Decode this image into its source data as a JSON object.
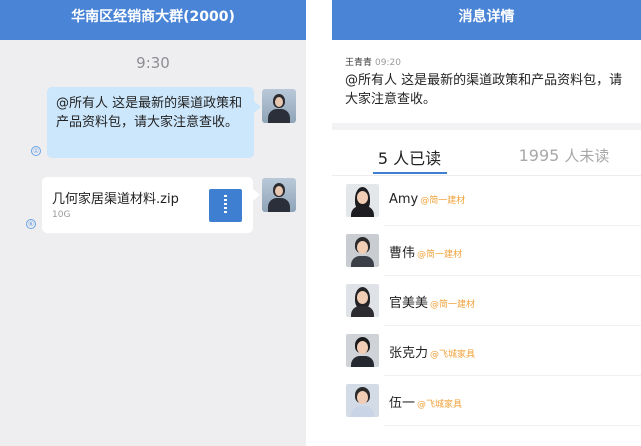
{
  "left": {
    "title": "华南区经销商大群(2000)",
    "time": "9:30",
    "message_text": "@所有人 这是最新的渠道政策和产品资料包，请大家注意查收。",
    "read_indicator_1": "①",
    "read_indicator_2": "⑥",
    "file": {
      "name": "几何家居渠道材料.zip",
      "size": "10G",
      "icon": "zip-file-icon"
    }
  },
  "right": {
    "title": "消息详情",
    "sender": "王青青",
    "sent_time": "09:20",
    "message_text": "@所有人 这是最新的渠道政策和产品资料包，请大家注意查收。",
    "tabs": {
      "read_count": "5",
      "read_label": "人已读",
      "unread_count": "1995",
      "unread_label": "人未读"
    },
    "readers": [
      {
        "name": "Amy",
        "company": "@简一建材"
      },
      {
        "name": "曹伟",
        "company": "@简一建材"
      },
      {
        "name": "官美美",
        "company": "@简一建材"
      },
      {
        "name": "张克力",
        "company": "@飞城家具"
      },
      {
        "name": "伍一",
        "company": "@飞城家具"
      }
    ]
  },
  "colors": {
    "header": "#4a84d6",
    "bubble": "#cce6fb",
    "company_tag": "#f0a23a",
    "tab_active": "#3f7fd2"
  }
}
